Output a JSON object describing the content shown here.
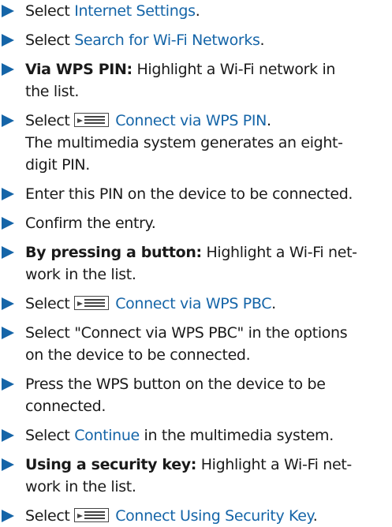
{
  "steps": [
    {
      "parts": [
        {
          "t": "Select "
        },
        {
          "t": "Internet Settings",
          "c": "link"
        },
        {
          "t": "."
        }
      ]
    },
    {
      "parts": [
        {
          "t": "Select "
        },
        {
          "t": "Search for Wi-Fi Networks",
          "c": "link"
        },
        {
          "t": "."
        }
      ]
    },
    {
      "parts": [
        {
          "t": "Via WPS PIN:",
          "c": "bold"
        },
        {
          "t": " Highlight a Wi-Fi network in"
        }
      ],
      "cont": [
        "the list."
      ]
    },
    {
      "parts": [
        {
          "t": "Select "
        },
        {
          "icon": "menu-icon"
        },
        {
          "t": "Connect via WPS PIN",
          "c": "link"
        },
        {
          "t": "."
        }
      ],
      "cont": [
        "The multimedia system generates an eight-",
        "digit PIN."
      ]
    },
    {
      "parts": [
        {
          "t": "Enter this PIN on the device to be connected."
        }
      ]
    },
    {
      "parts": [
        {
          "t": "Confirm the entry."
        }
      ]
    },
    {
      "parts": [
        {
          "t": "By pressing a button:",
          "c": "bold"
        },
        {
          "t": " Highlight a Wi-Fi net-"
        }
      ],
      "cont": [
        "work in the list."
      ]
    },
    {
      "parts": [
        {
          "t": "Select "
        },
        {
          "icon": "menu-icon"
        },
        {
          "t": "Connect via WPS PBC",
          "c": "link"
        },
        {
          "t": "."
        }
      ]
    },
    {
      "parts": [
        {
          "t": "Select \"Connect via WPS PBC\" in the options"
        }
      ],
      "cont": [
        "on the device to be connected."
      ]
    },
    {
      "parts": [
        {
          "t": "Press the WPS button on the device to be"
        }
      ],
      "cont": [
        "connected."
      ]
    },
    {
      "parts": [
        {
          "t": "Select "
        },
        {
          "t": "Continue",
          "c": "link"
        },
        {
          "t": " in the multimedia system."
        }
      ]
    },
    {
      "parts": [
        {
          "t": "Using a security key:",
          "c": "bold"
        },
        {
          "t": " Highlight a Wi-Fi net-"
        }
      ],
      "cont": [
        "work in the list."
      ]
    },
    {
      "parts": [
        {
          "t": "Select "
        },
        {
          "icon": "menu-icon"
        },
        {
          "t": "Connect Using Security Key",
          "c": "link"
        },
        {
          "t": "."
        }
      ]
    }
  ]
}
